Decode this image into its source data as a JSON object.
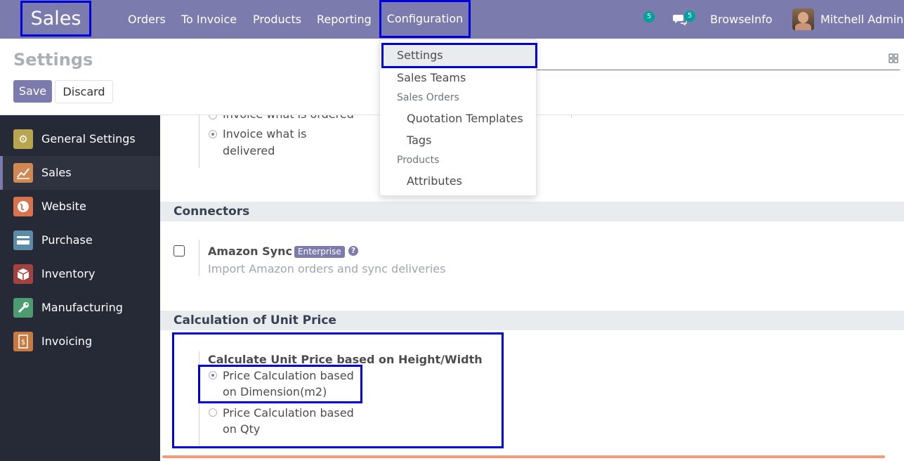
{
  "navbar": {
    "brand": "Sales",
    "menu": [
      "Orders",
      "To Invoice",
      "Products",
      "Reporting",
      "Configuration"
    ],
    "activity_count": "5",
    "messages_count": "5",
    "company": "BrowseInfo",
    "user": "Mitchell Admin"
  },
  "control_panel": {
    "title": "Settings",
    "save_label": "Save",
    "discard_label": "Discard"
  },
  "dropdown": {
    "settings": "Settings",
    "sales_teams": "Sales Teams",
    "sales_orders_header": "Sales Orders",
    "quotation_templates": "Quotation Templates",
    "tags": "Tags",
    "products_header": "Products",
    "attributes": "Attributes"
  },
  "sidebar": {
    "items": [
      {
        "label": "General Settings",
        "icon": "gear-icon",
        "color": "#b7a54f"
      },
      {
        "label": "Sales",
        "icon": "chart-icon",
        "color": "#d08953"
      },
      {
        "label": "Website",
        "icon": "globe-icon",
        "color": "#d8734d"
      },
      {
        "label": "Purchase",
        "icon": "card-icon",
        "color": "#5b8ba6"
      },
      {
        "label": "Inventory",
        "icon": "box-icon",
        "color": "#a3423f"
      },
      {
        "label": "Manufacturing",
        "icon": "wrench-icon",
        "color": "#4c9c72"
      },
      {
        "label": "Invoicing",
        "icon": "invoice-icon",
        "color": "#c77b43"
      }
    ]
  },
  "content": {
    "invoice_ordered": "Invoice what is ordered",
    "invoice_delivered_line1": "Invoice what is",
    "invoice_delivered_line2": "delivered",
    "connectors_title": "Connectors",
    "amazon_label": "Amazon Sync",
    "enterprise_badge": "Enterprise",
    "amazon_desc": "Import Amazon orders and sync deliveries",
    "unit_price_title": "Calculation of Unit Price",
    "unit_price_label": "Calculate Unit Price based on Height/Width",
    "option_dimension_line1": "Price Calculation based",
    "option_dimension_line2": "on Dimension(m2)",
    "option_qty_line1": "Price Calculation based",
    "option_qty_line2": "on Qty"
  },
  "colors": {
    "primary": "#7c7bad",
    "highlight": "#0000dd",
    "sidebar_bg": "#262a36",
    "badge": "#00a09d"
  }
}
